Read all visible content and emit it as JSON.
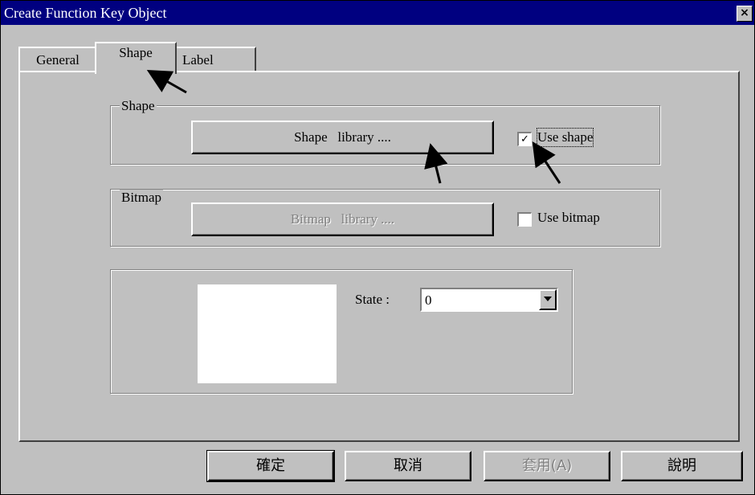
{
  "window": {
    "title": "Create Function Key Object",
    "close_symbol": "×"
  },
  "tabs": [
    {
      "label": "General",
      "active": false
    },
    {
      "label": "Shape",
      "active": true
    },
    {
      "label": "Label",
      "active": false
    }
  ],
  "shape_group": {
    "label": "Shape",
    "library_button": "Shape   library ....",
    "use_checkbox_label": "Use shape",
    "use_checked": true,
    "check_mark": "✓"
  },
  "bitmap_group": {
    "label": "Bitmap",
    "library_button": "Bitmap   library ....",
    "library_button_enabled": false,
    "use_checkbox_label": "Use bitmap",
    "use_checked": false
  },
  "state": {
    "label": "State :",
    "value": "0"
  },
  "footer": {
    "ok": "確定",
    "cancel": "取消",
    "apply": "套用(A)",
    "apply_enabled": false,
    "help": "說明"
  }
}
